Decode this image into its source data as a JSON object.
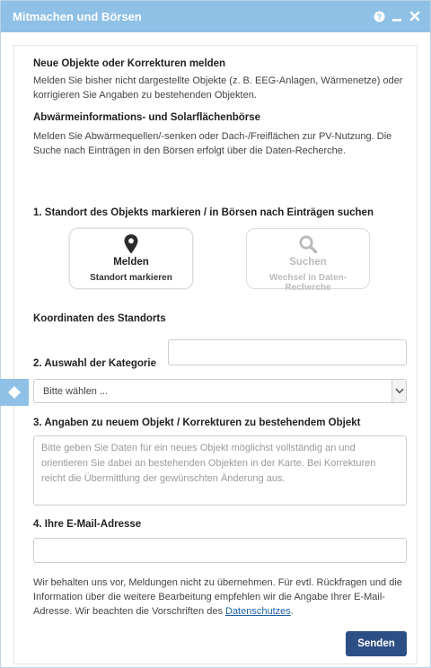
{
  "window": {
    "title": "Mitmachen und Börsen"
  },
  "icons": {
    "help": "question-circle-icon",
    "minimize": "minimize-icon",
    "close": "close-icon",
    "marker": "map-marker-icon",
    "search": "magnifier-icon",
    "side_tab": "diamond-icon",
    "dropdown": "chevron-down-icon"
  },
  "intro": {
    "heading1": "Neue Objekte oder Korrekturen melden",
    "text1": "Melden Sie bisher nicht dargestellte Objekte (z. B. EEG-Anlagen, Wärmenetze) oder korrigieren Sie Angaben zu bestehenden Objekten.",
    "heading2": "Abwärmeinformations- und Solarflächenbörse",
    "text2": "Melden Sie Abwärmequellen/-senken oder Dach-/Freiflächen zur PV-Nutzung. Die Suche nach Einträgen in den Börsen erfolgt über die Daten-Recherche."
  },
  "step1": {
    "heading": "1. Standort des Objekts markieren / in Börsen nach Einträgen suchen",
    "report_title": "Melden",
    "report_sub": "Standort markieren",
    "search_title": "Suchen",
    "search_sub": "Wechsel in Daten-Recherche"
  },
  "coords": {
    "label": "Koordinaten des Standorts",
    "value": ""
  },
  "step2": {
    "heading": "2. Auswahl der Kategorie",
    "selected": "Bitte wählen ..."
  },
  "step3": {
    "heading": "3. Angaben zu neuem Objekt / Korrekturen zu bestehendem Objekt",
    "placeholder": "Bitte geben Sie Daten für ein neues Objekt möglichst vollständig an und orientieren Sie dabei an bestehenden Objekten in der Karte. Bei Korrekturen reicht die Übermittlung der gewünschten Änderung aus."
  },
  "step4": {
    "heading": "4. Ihre E-Mail-Adresse",
    "value": ""
  },
  "footer": {
    "text": "Wir behalten uns vor, Meldungen nicht zu übernehmen. Für evtl. Rückfragen und die Information über die weitere Bearbeitung empfehlen wir die Angabe Ihrer E-Mail-Adresse. Wir beachten die Vorschriften des ",
    "link": "Datenschutzes",
    "after": ".",
    "submit": "Senden"
  },
  "colors": {
    "titlebar": "#8fc0e6",
    "button": "#2c4f86",
    "link": "#1e5fa8"
  }
}
